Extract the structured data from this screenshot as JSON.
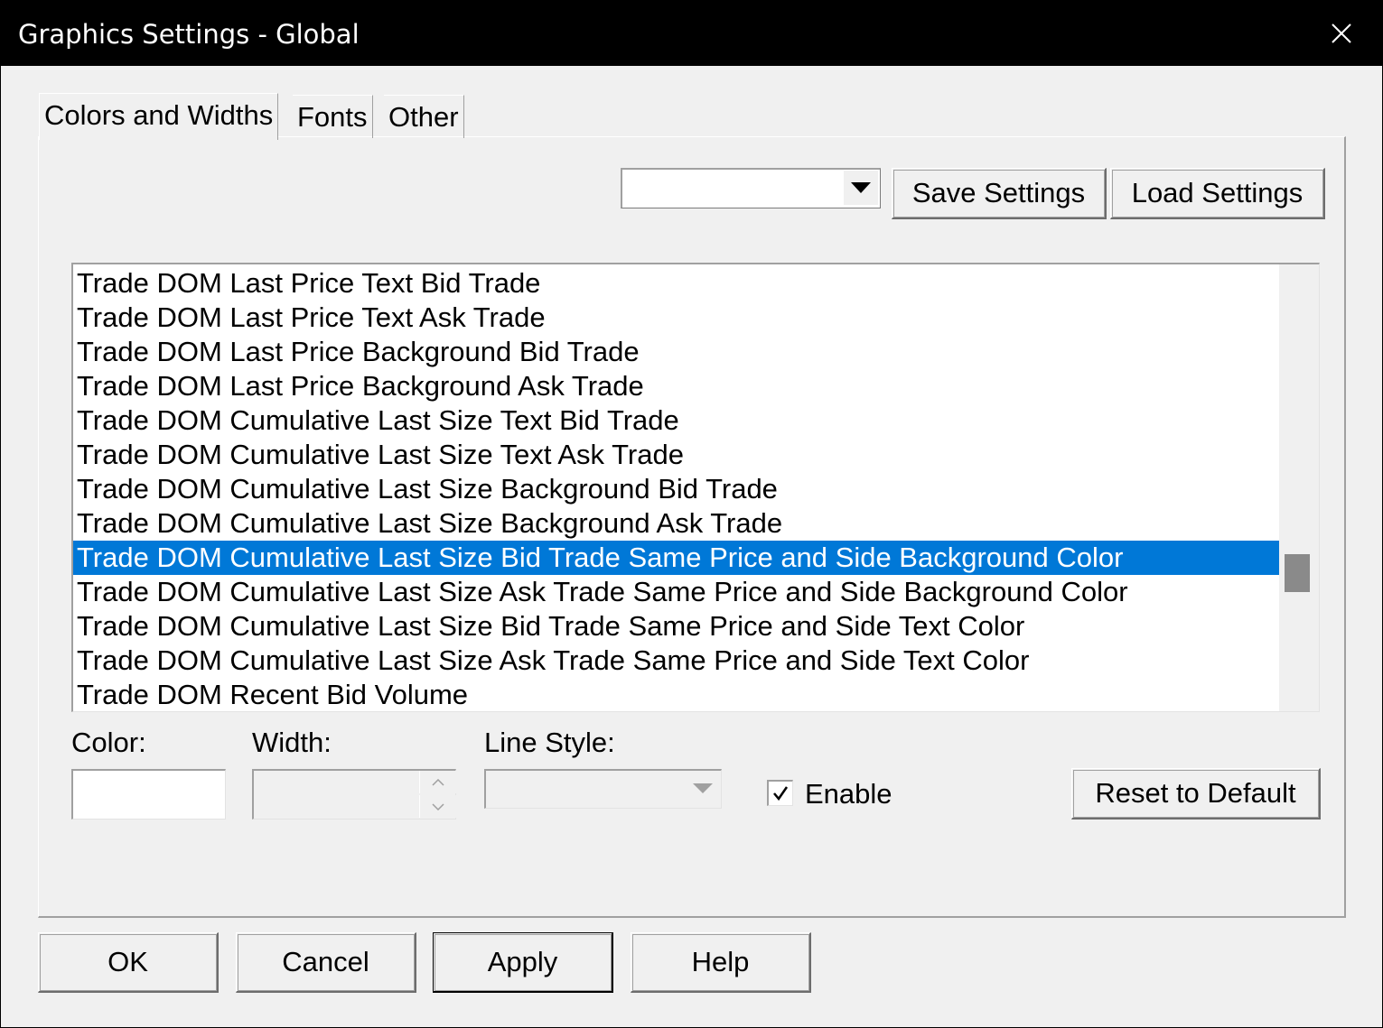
{
  "window": {
    "title": "Graphics Settings - Global",
    "close_icon": "close-icon"
  },
  "tabs": [
    {
      "label": "Colors and Widths",
      "active": true
    },
    {
      "label": "Fonts",
      "active": false
    },
    {
      "label": "Other",
      "active": false
    }
  ],
  "toolbar": {
    "preset_value": "",
    "save_label": "Save Settings",
    "load_label": "Load Settings"
  },
  "list": {
    "items": [
      "Trade DOM Last Price Text Bid Trade",
      "Trade DOM Last Price Text Ask Trade",
      "Trade DOM Last Price Background Bid Trade",
      "Trade DOM Last Price Background Ask Trade",
      "Trade DOM Cumulative Last Size Text Bid Trade",
      "Trade DOM Cumulative Last Size Text Ask Trade",
      "Trade DOM Cumulative Last Size Background Bid Trade",
      "Trade DOM Cumulative Last Size Background Ask Trade",
      "Trade DOM Cumulative Last Size Bid Trade Same Price and Side Background Color",
      "Trade DOM Cumulative Last Size Ask Trade Same Price and Side Background Color",
      "Trade DOM Cumulative Last Size Bid Trade Same Price and Side Text Color",
      "Trade DOM Cumulative Last Size Ask Trade Same Price and Side Text Color",
      "Trade DOM Recent Bid Volume"
    ],
    "selected_index": 8
  },
  "properties": {
    "color_label": "Color:",
    "color_value": "#ffffff",
    "width_label": "Width:",
    "width_value": "",
    "line_style_label": "Line Style:",
    "line_style_value": "",
    "enable_label": "Enable",
    "enable_checked": true,
    "reset_label": "Reset to Default"
  },
  "footer": {
    "ok_label": "OK",
    "cancel_label": "Cancel",
    "apply_label": "Apply",
    "help_label": "Help"
  },
  "colors": {
    "selection": "#0078d7",
    "titlebar": "#000000",
    "scroll_thumb": "#8a8a8a"
  }
}
